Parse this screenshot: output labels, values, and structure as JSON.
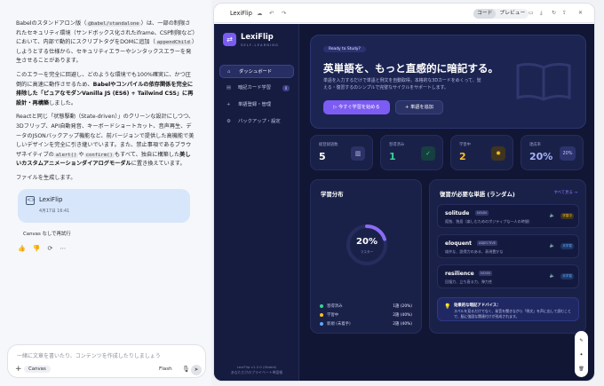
{
  "chat": {
    "p1_a": "Babelのスタンドアロン版（",
    "p1_code1": "@babel/standalone",
    "p1_b": "）は、一部の制限されたセキュリティ環境（サンドボックス化されたiframe、CSP制限など）において、内部で動的にスクリプトタグをDOMに追加（",
    "p1_code2": "appendChild",
    "p1_c": "）しようとする仕様から、セキュリティエラーやシンタックスエラーを発生させることがあります。",
    "p2_a": "このエラーを完全に回避し、どのような環境でも100%確実に、かつ圧倒的に高速に動作させるため、",
    "p2_b": "Babelやコンパイルの依存関係を完全に排除した「ピュアなモダンVanilla JS (ES6) + Tailwind CSS」に再設計・再構築",
    "p2_c": "しました。",
    "p3_a": "Reactと同じ「状態駆動（State-driven）」のクリーンな設計にしつつ、3Dフリップ、API自動発音、キーボードショートカット、音声再生、データのJSONバックアップ機能など、前バージョンで提供した高機能で美しいデザインを完全に引き継いでいます。また、禁止事項であるブラウザネイティブの",
    "p3_code1": "alert()",
    "p3_mid": "や",
    "p3_code2": "confirm()",
    "p3_b": "もすべて、独自に構築した",
    "p3_bold": "美しいカスタムアニメーションダイアログモーダル",
    "p3_c": "に置き換えています。",
    "p4": "ファイルを生成します。",
    "card_title": "LexiFlip",
    "card_date": "4月17日 16:41",
    "canvas_btn": "Canvas なしで再試行",
    "input_placeholder": "一緒に文章を書いたり、コンテンツを作成したりしましょう",
    "canvas_chip": "Canvas",
    "model": "Flash"
  },
  "window": {
    "title": "LexiFlip",
    "tab_code": "コード",
    "tab_preview": "プレビュー"
  },
  "app": {
    "brand": "LexiFlip",
    "brand_sub": "SELF-LEARNING",
    "nav": [
      "ダッシュボード",
      "暗記カード学習",
      "単語登録・管理",
      "バックアップ・設定"
    ],
    "nav_badge": "0",
    "footer1": "LexiFlip v1.2.0 (Stable)",
    "footer2": "あなただけのプライベート単語帳",
    "hero_pill": "Ready to Study?",
    "hero_title": "英単語を、もっと直感的に暗記する。",
    "hero_desc": "単語を入力するだけで単語と例文を自動取得。本格的な3Dカードをめくって、覚える・復習するのシンプルで完璧なサイクルをサポートします。",
    "btn_start": "今すぐ学習を始める",
    "btn_add": "単語を追加",
    "stats": [
      {
        "label": "総登録語数",
        "value": "5",
        "color": "#ffffff"
      },
      {
        "label": "習得済み",
        "value": "1",
        "color": "#34d399"
      },
      {
        "label": "学習中",
        "value": "2",
        "color": "#fbbf24"
      },
      {
        "label": "達成率",
        "value": "20%",
        "color": "#a5b4fc",
        "badge": "20%"
      }
    ],
    "dist_title": "学習分布",
    "donut_value": "20%",
    "donut_label": "マスター",
    "donut_fraction": 0.2,
    "legend": [
      {
        "label": "習得済み",
        "value": "1語 (20%)",
        "color": "#34d399"
      },
      {
        "label": "学習中",
        "value": "2語 (40%)",
        "color": "#fbbf24"
      },
      {
        "label": "新規 (未着手)",
        "value": "2語 (40%)",
        "color": "#60a5fa"
      }
    ],
    "review_title": "復習が必要な単語 (ランダム)",
    "see_all": "すべて見る →",
    "words": [
      {
        "word": "solitude",
        "pos": "NOUN",
        "meaning": "孤独、独居（楽しむためのポジティブな一人の時間）",
        "tag": "学習中",
        "tagcolor": "#fbbf24"
      },
      {
        "word": "eloquent",
        "pos": "ADJECTIVE",
        "meaning": "雄弁な、説得力のある、表現豊かな",
        "tag": "未学習",
        "tagcolor": "#60a5fa"
      },
      {
        "word": "resilience",
        "pos": "NOUN",
        "meaning": "回復力、立ち直る力、弾力性",
        "tag": "未学習",
        "tagcolor": "#60a5fa"
      }
    ],
    "advice_title": "効果的な暗記アドバイス：",
    "advice_body": "スペルを見るだけでなく、発音を聞きながら「例文」を声に出して読むことで、脳に強固な関連付けが形成されます。"
  }
}
